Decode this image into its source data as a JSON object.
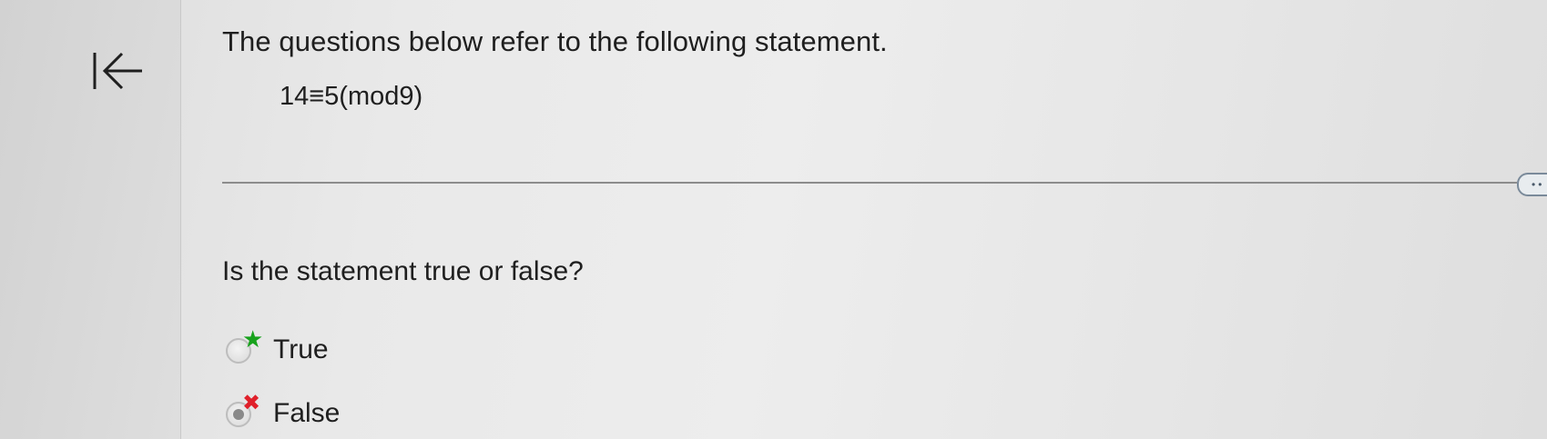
{
  "header": {
    "intro_text": "The questions below refer to the following statement.",
    "statement": "14≡5(mod9)"
  },
  "question": {
    "prompt": "Is the statement true or false?",
    "options": [
      {
        "label": "True",
        "marker": "★",
        "marker_icon": "star-icon",
        "marker_color": "#17a21c",
        "selected": false
      },
      {
        "label": "False",
        "marker": "✖",
        "marker_icon": "cross-icon",
        "marker_color": "#e0202a",
        "selected": true
      }
    ]
  },
  "pager": {
    "dots": "••"
  }
}
